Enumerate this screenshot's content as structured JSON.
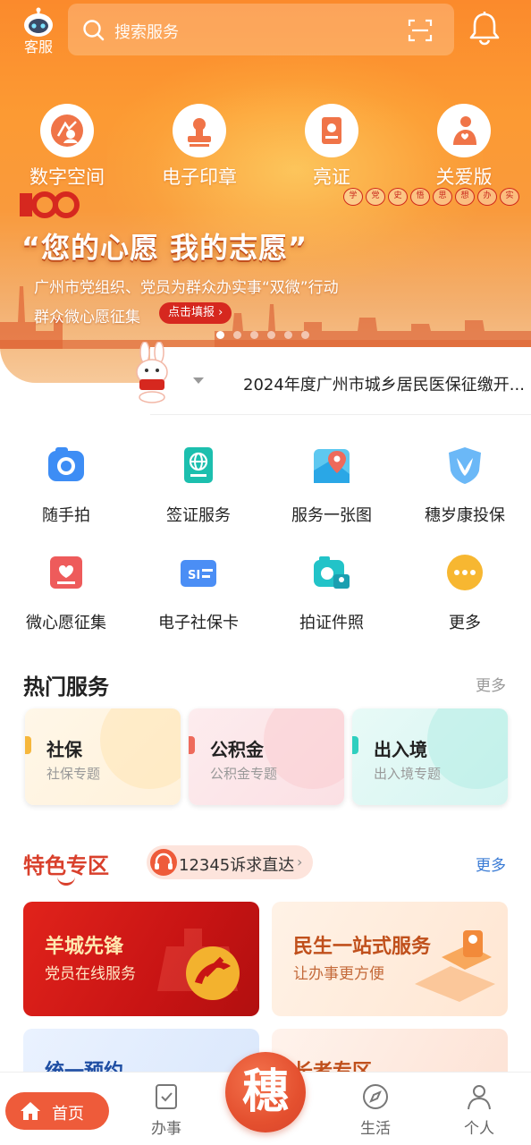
{
  "header": {
    "kefu_label": "客服",
    "search_placeholder": "搜索服务"
  },
  "quick_links": [
    {
      "label": "数字空间",
      "icon": "digital-space-icon"
    },
    {
      "label": "电子印章",
      "icon": "stamp-icon"
    },
    {
      "label": "亮证",
      "icon": "certificate-icon"
    },
    {
      "label": "关爱版",
      "icon": "care-icon"
    }
  ],
  "banner": {
    "badge": "100",
    "seals": [
      "学",
      "党",
      "史",
      "悟",
      "思",
      "想",
      "办",
      "实",
      "事",
      "开",
      "新",
      "局"
    ],
    "title": "“您的心愿 我的志愿”",
    "subtitle": "广州市党组织、党员为群众办实事“双微”行动",
    "subtitle2": "群众微心愿征集",
    "button": "点击填报",
    "slides_total": 6,
    "active_slide": 1
  },
  "notice": {
    "text": "2024年度广州市城乡居民医保征缴开..."
  },
  "services": [
    {
      "label": "随手拍",
      "icon": "camera-icon"
    },
    {
      "label": "签证服务",
      "icon": "visa-icon"
    },
    {
      "label": "服务一张图",
      "icon": "map-icon"
    },
    {
      "label": "穗岁康投保",
      "icon": "insurance-icon"
    },
    {
      "label": "微心愿征集",
      "icon": "wish-icon"
    },
    {
      "label": "电子社保卡",
      "icon": "social-card-icon"
    },
    {
      "label": "拍证件照",
      "icon": "id-photo-icon"
    },
    {
      "label": "更多",
      "icon": "more-icon"
    }
  ],
  "hot": {
    "title": "热门服务",
    "more": "更多",
    "cards": [
      {
        "name": "社保",
        "sub": "社保专题",
        "accent": "#f6b73c"
      },
      {
        "name": "公积金",
        "sub": "公积金专题",
        "accent": "#ee6a5b"
      },
      {
        "name": "出入境",
        "sub": "出入境专题",
        "accent": "#2fcfbf"
      }
    ]
  },
  "special": {
    "title": "特色专区",
    "hotline": "12345诉求直达",
    "more": "更多",
    "promos": [
      {
        "title": "羊城先锋",
        "sub": "党员在线服务"
      },
      {
        "title": "民生一站式服务",
        "sub": "让办事更方便"
      },
      {
        "title": "统一预约",
        "sub": ""
      },
      {
        "title": "长者专区",
        "sub": ""
      }
    ]
  },
  "tabbar": {
    "home": "首页",
    "tasks": "办事",
    "center": "穗",
    "life": "生活",
    "profile": "个人"
  },
  "colors": {
    "brand": "#ee5b3a",
    "link_blue": "#3a7bd5"
  }
}
